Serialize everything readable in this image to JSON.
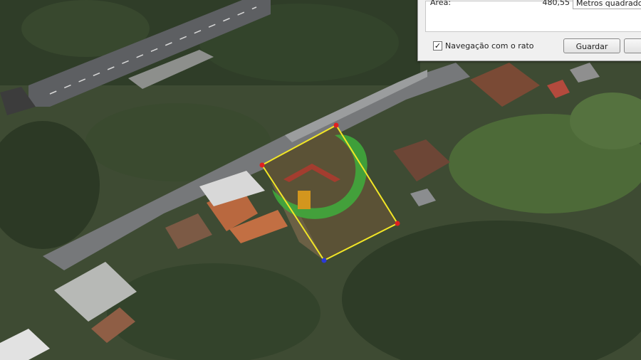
{
  "measure_panel": {
    "area_label": "Área:",
    "area_value": "480,55",
    "unit_selected": "Metros quadrados",
    "mouse_nav_label": "Navegação com o rato",
    "mouse_nav_checked": true,
    "check_glyph": "✓",
    "save_label": "Guardar"
  },
  "colors": {
    "polygon_edge": "#f2e626",
    "vertex_marker": "#e02020",
    "active_vertex_marker": "#2b3ad8",
    "watermark_green": "#3fae3c",
    "watermark_red": "#b03a2e",
    "watermark_orange": "#e8a21a"
  },
  "icons": {
    "watermark": "house-logo-watermark",
    "checkbox": "checkbox-checked-icon"
  }
}
